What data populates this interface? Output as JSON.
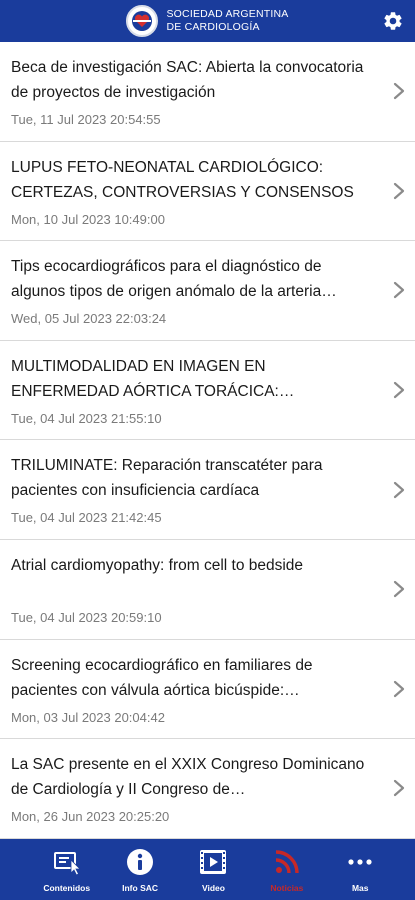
{
  "header": {
    "org_line1": "SOCIEDAD ARGENTINA",
    "org_line2": "DE CARDIOLOGÍA"
  },
  "news": [
    {
      "title": "Beca de investigación SAC: Abierta la convocatoria de proyectos de investigación",
      "date": "Tue, 11 Jul 2023 20:54:55"
    },
    {
      "title": "LUPUS FETO-NEONATAL CARDIOLÓGICO: CERTEZAS, CONTROVERSIAS Y CONSENSOS",
      "date": "Mon, 10 Jul 2023 10:49:00"
    },
    {
      "title": "Tips ecocardiográficos para el diagnóstico de algunos tipos de origen anómalo de la arteria…",
      "date": "Wed, 05 Jul 2023 22:03:24"
    },
    {
      "title": "MULTIMODALIDAD EN IMAGEN EN ENFERMEDAD AÓRTICA TORÁCICA:…",
      "date": "Tue, 04 Jul 2023 21:55:10"
    },
    {
      "title": "TRILUMINATE: Reparación transcatéter para pacientes con insuficiencia cardíaca",
      "date": "Tue, 04 Jul 2023 21:42:45"
    },
    {
      "title": "Atrial cardiomyopathy: from cell to bedside",
      "date": "Tue, 04 Jul 2023 20:59:10"
    },
    {
      "title": "Screening ecocardiográfico en familiares de pacientes con válvula aórtica bicúspide:…",
      "date": "Mon, 03 Jul 2023 20:04:42"
    },
    {
      "title": "La SAC presente en el XXIX Congreso Dominicano de Cardiología y II Congreso de…",
      "date": "Mon, 26 Jun 2023 20:25:20"
    }
  ],
  "tabs": [
    {
      "label": "Contenidos",
      "icon": "contents-icon"
    },
    {
      "label": "Info SAC",
      "icon": "info-icon"
    },
    {
      "label": "Video",
      "icon": "video-icon"
    },
    {
      "label": "Noticias",
      "icon": "rss-icon",
      "active": true
    },
    {
      "label": "Mas",
      "icon": "more-icon"
    }
  ],
  "colors": {
    "brand": "#1a3c9c",
    "active_tab": "#c62828",
    "date_text": "#7a7a7a"
  }
}
